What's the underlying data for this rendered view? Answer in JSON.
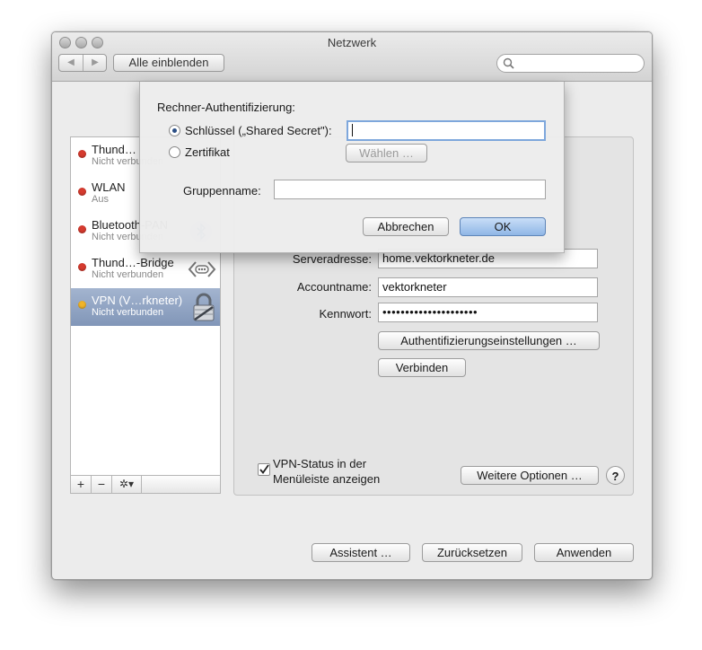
{
  "window": {
    "title": "Netzwerk",
    "show_all_label": "Alle einblenden",
    "back_glyph": "◀",
    "forward_glyph": "▶",
    "search_placeholder": ""
  },
  "sidebar": {
    "items": [
      {
        "name": "Thund…",
        "status": "Nicht verbunden",
        "dot_color": "#d63b2f",
        "selected": false
      },
      {
        "name": "WLAN",
        "status": "Aus",
        "dot_color": "#d63b2f",
        "selected": false
      },
      {
        "name": "Bluetooth-PAN",
        "status": "Nicht verbunden",
        "dot_color": "#d63b2f",
        "selected": false,
        "icon": "bluetooth-icon"
      },
      {
        "name": "Thund…-Bridge",
        "status": "Nicht verbunden",
        "dot_color": "#d63b2f",
        "selected": false,
        "icon": "bridge-arrows-icon"
      },
      {
        "name": "VPN (V…rkneter)",
        "status": "Nicht verbunden",
        "dot_color": "#f0b429",
        "selected": true,
        "icon": "lock-icon"
      }
    ],
    "add_glyph": "+",
    "remove_glyph": "−",
    "action_glyph": "✲▾"
  },
  "config": {
    "server_label": "Serveradresse:",
    "server_value": "home.vektorkneter.de",
    "account_label": "Accountname:",
    "account_value": "vektorkneter",
    "password_label": "Kennwort:",
    "password_value": "•••••••••••••••••••••",
    "auth_button": "Authentifizierungseinstellungen …",
    "connect_button": "Verbinden",
    "vpn_status_line1": "VPN-Status in der",
    "vpn_status_line2": "Menüleiste anzeigen",
    "vpn_status_checked": true,
    "more_options_button": "Weitere Optionen …",
    "help_glyph": "?"
  },
  "footer": {
    "assistant_button": "Assistent …",
    "revert_button": "Zurücksetzen",
    "apply_button": "Anwenden"
  },
  "sheet": {
    "heading": "Rechner-Authentifizierung:",
    "shared_secret_label": "Schlüssel („Shared Secret\"):",
    "shared_secret_selected": true,
    "shared_secret_value": "",
    "certificate_label": "Zertifikat",
    "choose_button": "Wählen …",
    "group_label": "Gruppenname:",
    "group_value": "",
    "cancel_button": "Abbrechen",
    "ok_button": "OK"
  },
  "colors": {
    "selection": "#8fa3c3",
    "default_button": "#8fb6e6"
  }
}
